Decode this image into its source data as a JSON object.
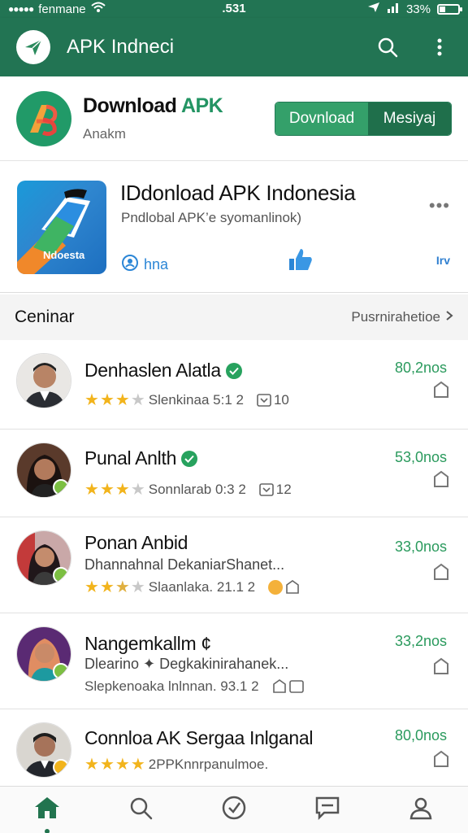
{
  "status": {
    "carrier": "fenmane",
    "time": ".531",
    "battery": "33%",
    "battery_level": 0.33
  },
  "toolbar": {
    "title": "APK Indneci",
    "search_icon": "search-icon",
    "more_icon": "more-vertical-icon"
  },
  "header": {
    "title_main": "Download ",
    "title_accent": "APK",
    "subtitle": "Anakm",
    "btn_download": "Dovnload",
    "btn_mesiyaj": "Mesiyaj"
  },
  "featured": {
    "title": "IDdonload APK Indonesia",
    "subtitle": "Pndlobal APK’e syomanlinok)",
    "icon_label": "Ndoesta",
    "link_label": "hna",
    "right_label": "Irv",
    "more": "•••"
  },
  "section": {
    "title": "Ceninar",
    "link": "Pusrnirahetioe"
  },
  "rows": [
    {
      "name": "Denhaslen Alatla",
      "verified": true,
      "stars": 3.5,
      "meta": "Slenkinaa  5:1 2",
      "extra": "10",
      "price": "80,2nos",
      "desc": ""
    },
    {
      "name": "Punal Anlth",
      "verified": true,
      "stars": 3,
      "meta": "Sonnlarab  0:3 2",
      "extra": "12",
      "price": "53,0nos",
      "desc": ""
    },
    {
      "name": "Ponan Anbid",
      "verified": false,
      "stars": 2.5,
      "desc": "Dhannahnal DekaniarShanet...",
      "meta": "Slaanlaka. 21.1 2",
      "extra": "",
      "price": "33,0nos"
    },
    {
      "name": "Nangemkallm ¢",
      "verified": false,
      "stars": 0,
      "desc": "Dlearino ✦ Degkakinirahanek...",
      "meta": "Slepkenoaka  lnlnnan. 93.1 2",
      "extra": "",
      "price": "33,2nos"
    },
    {
      "name": "Connloa AK Sergaa Inlganal",
      "verified": false,
      "stars": 4,
      "desc": "",
      "meta": "2PPKnnrpanulmoe.",
      "extra": "",
      "price": "80,0nos"
    }
  ],
  "nav": [
    "home-icon",
    "search-icon",
    "check-circle-icon",
    "message-icon",
    "profile-icon"
  ],
  "colors": {
    "primary": "#227453",
    "accent": "#2a9a5d",
    "star": "#f2b41c"
  }
}
